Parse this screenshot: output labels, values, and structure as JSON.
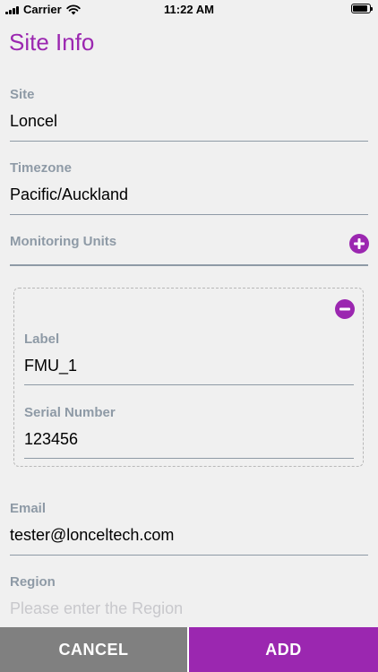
{
  "status_bar": {
    "carrier": "Carrier",
    "time": "11:22 AM"
  },
  "header": {
    "title": "Site Info"
  },
  "form": {
    "site": {
      "label": "Site",
      "value": "Loncel"
    },
    "timezone": {
      "label": "Timezone",
      "value": "Pacific/Auckland"
    },
    "monitoring_units": {
      "label": "Monitoring Units",
      "units": [
        {
          "label_field": {
            "label": "Label",
            "value": "FMU_1"
          },
          "serial_field": {
            "label": "Serial Number",
            "value": "123456"
          }
        }
      ]
    },
    "email": {
      "label": "Email",
      "value": "tester@lonceltech.com"
    },
    "region": {
      "label": "Region",
      "placeholder": "Please enter the Region"
    }
  },
  "actions": {
    "cancel_label": "CANCEL",
    "add_label": "ADD"
  },
  "colors": {
    "accent": "#9b27b0",
    "label_gray": "#8e9aa6",
    "cancel_gray": "#808080"
  }
}
